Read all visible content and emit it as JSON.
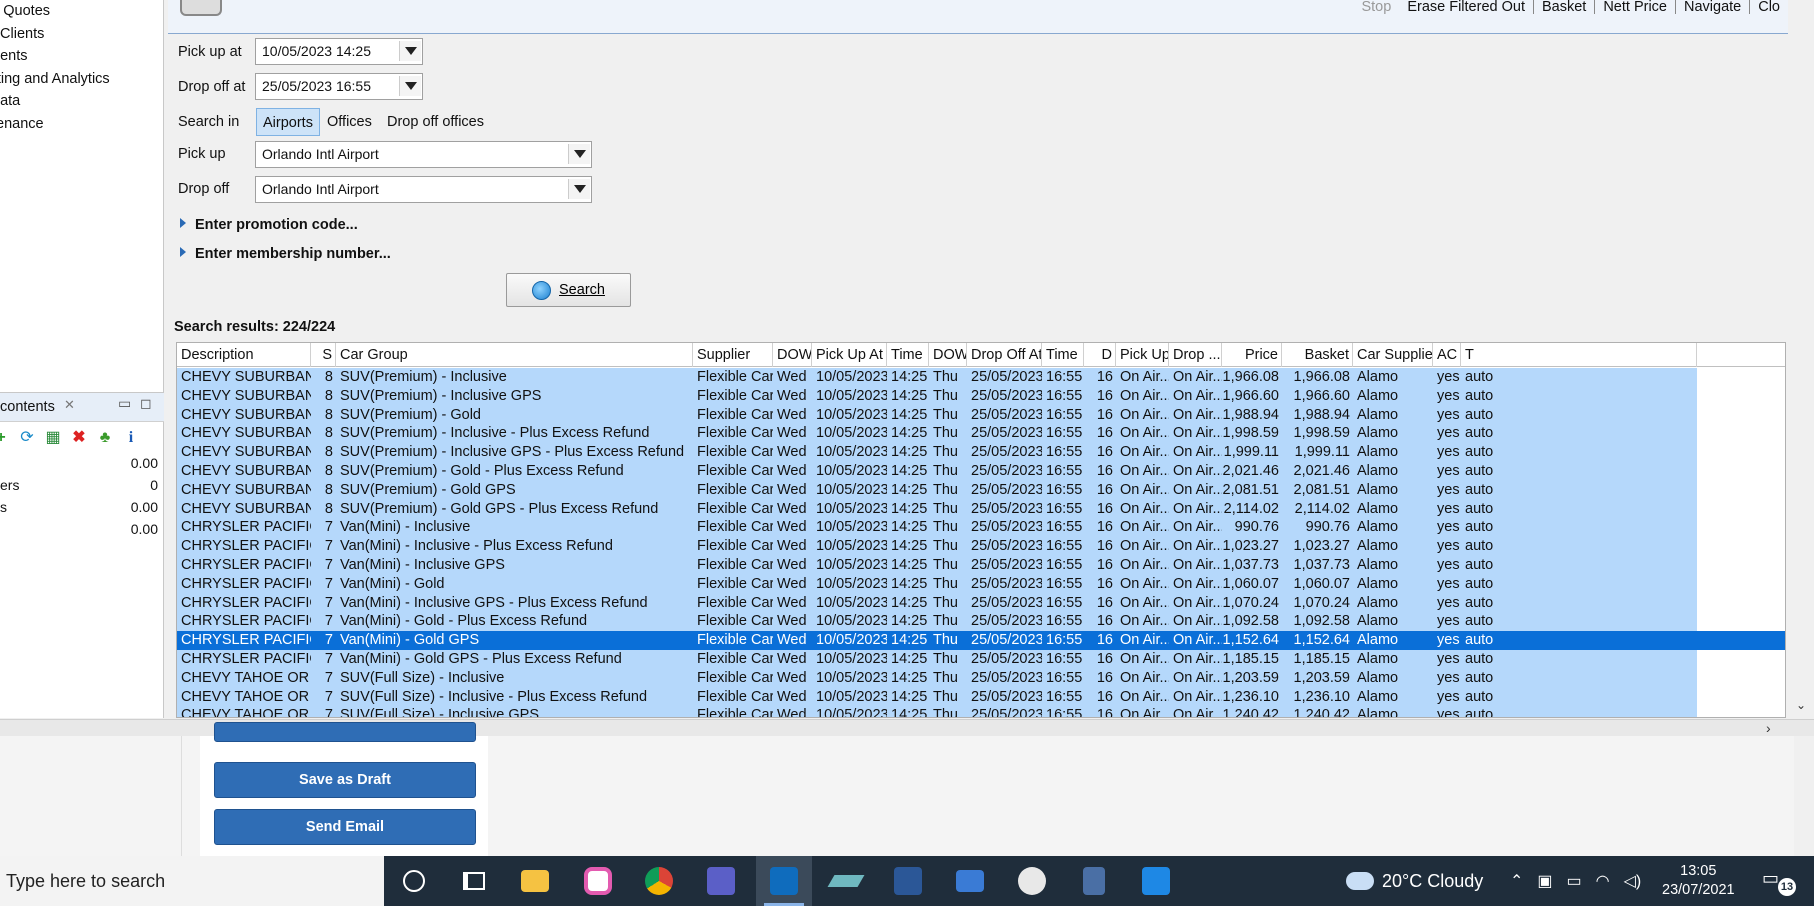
{
  "nav": {
    "items": [
      "k Quotes",
      "t Clients",
      "nents",
      "rting and Analytics",
      "data",
      "tenance"
    ]
  },
  "contents_panel": {
    "tab_label": "contents",
    "close_glyph": "✕",
    "rows": [
      {
        "label": "",
        "value": "0.00"
      },
      {
        "label": "ers",
        "value": "0"
      },
      {
        "label": "s",
        "value": "0.00"
      },
      {
        "label": "",
        "value": "0.00"
      }
    ]
  },
  "toolbar": {
    "stop": "Stop",
    "erase": "Erase Filtered Out",
    "basket": "Basket",
    "nett": "Nett Price",
    "navigate": "Navigate",
    "close": "Clo"
  },
  "form": {
    "pickup_at_label": "Pick up at",
    "pickup_at": "10/05/2023 14:25",
    "dropoff_at_label": "Drop off at",
    "dropoff_at": "25/05/2023 16:55",
    "search_in_label": "Search in",
    "search_in_options": [
      "Airports",
      "Offices",
      "Drop off offices"
    ],
    "pickup_label": "Pick up",
    "pickup": "Orlando Intl Airport",
    "dropoff_label": "Drop off",
    "dropoff": "Orlando Intl Airport",
    "promo": "Enter promotion code...",
    "membership": "Enter membership number...",
    "search_button": "Search"
  },
  "results": {
    "title": "Search results: 224/224",
    "columns": [
      "Description",
      "S",
      "Car Group",
      "Supplier",
      "DOW",
      "Pick Up At",
      "Time",
      "DOW",
      "Drop Off At",
      "Time",
      "D",
      "Pick Up",
      "Drop ...",
      "Price",
      "Basket",
      "Car Supplier",
      "AC",
      "T"
    ],
    "rows": [
      [
        "CHEVY SUBURBAN ...",
        "8",
        "SUV(Premium) - Inclusive",
        "Flexible Car...",
        "Wed",
        "10/05/2023",
        "14:25",
        "Thu",
        "25/05/2023",
        "16:55",
        "16",
        "On Air...",
        "On Air...",
        "1,966.08",
        "1,966.08",
        "Alamo",
        "yes",
        "auto"
      ],
      [
        "CHEVY SUBURBAN ...",
        "8",
        "SUV(Premium) - Inclusive GPS",
        "Flexible Car...",
        "Wed",
        "10/05/2023",
        "14:25",
        "Thu",
        "25/05/2023",
        "16:55",
        "16",
        "On Air...",
        "On Air...",
        "1,966.60",
        "1,966.60",
        "Alamo",
        "yes",
        "auto"
      ],
      [
        "CHEVY SUBURBAN ...",
        "8",
        "SUV(Premium) - Gold",
        "Flexible Car...",
        "Wed",
        "10/05/2023",
        "14:25",
        "Thu",
        "25/05/2023",
        "16:55",
        "16",
        "On Air...",
        "On Air...",
        "1,988.94",
        "1,988.94",
        "Alamo",
        "yes",
        "auto"
      ],
      [
        "CHEVY SUBURBAN ...",
        "8",
        "SUV(Premium) - Inclusive - Plus Excess Refund",
        "Flexible Car...",
        "Wed",
        "10/05/2023",
        "14:25",
        "Thu",
        "25/05/2023",
        "16:55",
        "16",
        "On Air...",
        "On Air...",
        "1,998.59",
        "1,998.59",
        "Alamo",
        "yes",
        "auto"
      ],
      [
        "CHEVY SUBURBAN ...",
        "8",
        "SUV(Premium) - Inclusive GPS - Plus Excess Refund",
        "Flexible Car...",
        "Wed",
        "10/05/2023",
        "14:25",
        "Thu",
        "25/05/2023",
        "16:55",
        "16",
        "On Air...",
        "On Air...",
        "1,999.11",
        "1,999.11",
        "Alamo",
        "yes",
        "auto"
      ],
      [
        "CHEVY SUBURBAN ...",
        "8",
        "SUV(Premium) - Gold - Plus Excess Refund",
        "Flexible Car...",
        "Wed",
        "10/05/2023",
        "14:25",
        "Thu",
        "25/05/2023",
        "16:55",
        "16",
        "On Air...",
        "On Air...",
        "2,021.46",
        "2,021.46",
        "Alamo",
        "yes",
        "auto"
      ],
      [
        "CHEVY SUBURBAN ...",
        "8",
        "SUV(Premium) - Gold GPS",
        "Flexible Car...",
        "Wed",
        "10/05/2023",
        "14:25",
        "Thu",
        "25/05/2023",
        "16:55",
        "16",
        "On Air...",
        "On Air...",
        "2,081.51",
        "2,081.51",
        "Alamo",
        "yes",
        "auto"
      ],
      [
        "CHEVY SUBURBAN ...",
        "8",
        "SUV(Premium) - Gold GPS - Plus Excess Refund",
        "Flexible Car...",
        "Wed",
        "10/05/2023",
        "14:25",
        "Thu",
        "25/05/2023",
        "16:55",
        "16",
        "On Air...",
        "On Air...",
        "2,114.02",
        "2,114.02",
        "Alamo",
        "yes",
        "auto"
      ],
      [
        "CHRYSLER PACIFIC...",
        "7",
        "Van(Mini) - Inclusive",
        "Flexible Car...",
        "Wed",
        "10/05/2023",
        "14:25",
        "Thu",
        "25/05/2023",
        "16:55",
        "16",
        "On Air...",
        "On Air...",
        "990.76",
        "990.76",
        "Alamo",
        "yes",
        "auto"
      ],
      [
        "CHRYSLER PACIFIC...",
        "7",
        "Van(Mini) - Inclusive - Plus Excess Refund",
        "Flexible Car...",
        "Wed",
        "10/05/2023",
        "14:25",
        "Thu",
        "25/05/2023",
        "16:55",
        "16",
        "On Air...",
        "On Air...",
        "1,023.27",
        "1,023.27",
        "Alamo",
        "yes",
        "auto"
      ],
      [
        "CHRYSLER PACIFIC...",
        "7",
        "Van(Mini) - Inclusive GPS",
        "Flexible Car...",
        "Wed",
        "10/05/2023",
        "14:25",
        "Thu",
        "25/05/2023",
        "16:55",
        "16",
        "On Air...",
        "On Air...",
        "1,037.73",
        "1,037.73",
        "Alamo",
        "yes",
        "auto"
      ],
      [
        "CHRYSLER PACIFIC...",
        "7",
        "Van(Mini) - Gold",
        "Flexible Car...",
        "Wed",
        "10/05/2023",
        "14:25",
        "Thu",
        "25/05/2023",
        "16:55",
        "16",
        "On Air...",
        "On Air...",
        "1,060.07",
        "1,060.07",
        "Alamo",
        "yes",
        "auto"
      ],
      [
        "CHRYSLER PACIFIC...",
        "7",
        "Van(Mini) - Inclusive GPS - Plus Excess Refund",
        "Flexible Car...",
        "Wed",
        "10/05/2023",
        "14:25",
        "Thu",
        "25/05/2023",
        "16:55",
        "16",
        "On Air...",
        "On Air...",
        "1,070.24",
        "1,070.24",
        "Alamo",
        "yes",
        "auto"
      ],
      [
        "CHRYSLER PACIFIC...",
        "7",
        "Van(Mini) - Gold - Plus Excess Refund",
        "Flexible Car...",
        "Wed",
        "10/05/2023",
        "14:25",
        "Thu",
        "25/05/2023",
        "16:55",
        "16",
        "On Air...",
        "On Air...",
        "1,092.58",
        "1,092.58",
        "Alamo",
        "yes",
        "auto"
      ],
      [
        "CHRYSLER PACIFIC...",
        "7",
        "Van(Mini) - Gold GPS",
        "Flexible Car...",
        "Wed",
        "10/05/2023",
        "14:25",
        "Thu",
        "25/05/2023",
        "16:55",
        "16",
        "On Air...",
        "On Air...",
        "1,152.64",
        "1,152.64",
        "Alamo",
        "yes",
        "auto"
      ],
      [
        "CHRYSLER PACIFIC...",
        "7",
        "Van(Mini) - Gold GPS - Plus Excess Refund",
        "Flexible Car...",
        "Wed",
        "10/05/2023",
        "14:25",
        "Thu",
        "25/05/2023",
        "16:55",
        "16",
        "On Air...",
        "On Air...",
        "1,185.15",
        "1,185.15",
        "Alamo",
        "yes",
        "auto"
      ],
      [
        "CHEVY TAHOE OR ...",
        "7",
        "SUV(Full Size) - Inclusive",
        "Flexible Car...",
        "Wed",
        "10/05/2023",
        "14:25",
        "Thu",
        "25/05/2023",
        "16:55",
        "16",
        "On Air...",
        "On Air...",
        "1,203.59",
        "1,203.59",
        "Alamo",
        "yes",
        "auto"
      ],
      [
        "CHEVY TAHOE OR ...",
        "7",
        "SUV(Full Size) - Inclusive - Plus Excess Refund",
        "Flexible Car...",
        "Wed",
        "10/05/2023",
        "14:25",
        "Thu",
        "25/05/2023",
        "16:55",
        "16",
        "On Air...",
        "On Air...",
        "1,236.10",
        "1,236.10",
        "Alamo",
        "yes",
        "auto"
      ],
      [
        "CHEVY TAHOE OR ...",
        "7",
        "SUV(Full Size) - Inclusive GPS",
        "Flexible Car...",
        "Wed",
        "10/05/2023",
        "14:25",
        "Thu",
        "25/05/2023",
        "16:55",
        "16",
        "On Air...",
        "On Air...",
        "1,240.42",
        "1,240.42",
        "Alamo",
        "yes",
        "auto"
      ]
    ],
    "selected_row": 14
  },
  "lower": {
    "save_draft": "Save as Draft",
    "send_email": "Send Email"
  },
  "taskbar": {
    "search_placeholder": "Type here to search",
    "weather": "20°C  Cloudy",
    "time": "13:05",
    "date": "23/07/2021",
    "notif_count": "13"
  },
  "colors": {
    "row_highlight": "#b5d8fb",
    "row_selected": "#0a6fd8",
    "button_blue": "#2f6db5",
    "taskbar": "#1f2d3b"
  }
}
